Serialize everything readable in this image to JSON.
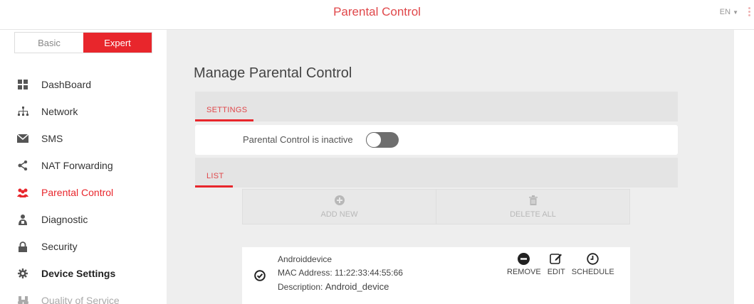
{
  "header": {
    "title": "Parental Control",
    "language": "EN"
  },
  "mode": {
    "basic": "Basic",
    "expert": "Expert"
  },
  "sidebar": {
    "items": [
      {
        "label": "DashBoard",
        "icon": "dashboard-icon"
      },
      {
        "label": "Network",
        "icon": "network-icon"
      },
      {
        "label": "SMS",
        "icon": "sms-icon"
      },
      {
        "label": "NAT Forwarding",
        "icon": "share-icon"
      },
      {
        "label": "Parental Control",
        "icon": "users-icon"
      },
      {
        "label": "Diagnostic",
        "icon": "diagnostic-icon"
      },
      {
        "label": "Security",
        "icon": "lock-icon"
      },
      {
        "label": "Device Settings",
        "icon": "gear-icon"
      },
      {
        "label": "Quality of Service",
        "icon": "binoculars-icon"
      }
    ]
  },
  "main": {
    "title": "Manage Parental Control",
    "settings_tab": "SETTINGS",
    "toggle_label": "Parental Control is inactive",
    "toggle_on": false,
    "list_tab": "LIST",
    "add_new": "ADD NEW",
    "delete_all": "DELETE ALL",
    "device": {
      "name": "Androiddevice",
      "mac_label": "MAC Address:",
      "mac_value": "11:22:33:44:55:66",
      "desc_label": "Description:",
      "desc_value": "Android_device",
      "remove": "REMOVE",
      "edit": "EDIT",
      "schedule": "SCHEDULE"
    }
  },
  "colors": {
    "accent": "#e8262c",
    "title_red": "#e0474a",
    "content_bg": "#eeeeee"
  }
}
